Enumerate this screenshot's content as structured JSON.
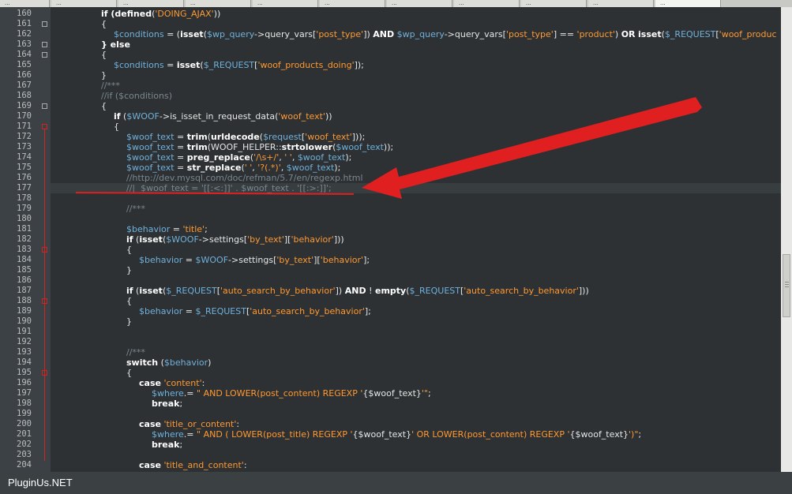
{
  "tabs": [
    "...",
    "...",
    "...",
    "...",
    "...",
    "...",
    "...",
    "...",
    "...",
    "...",
    "..."
  ],
  "footer": {
    "brand": "PluginUs.NET"
  },
  "annotation": {
    "color": "#e02020",
    "kind": "arrow-pointing-left"
  },
  "lines": [
    {
      "n": "160",
      "fold": "none",
      "indent": 2,
      "segs": [
        [
          "kw",
          "if ("
        ],
        [
          "fn",
          "defined"
        ],
        [
          "plain",
          "("
        ],
        [
          "str",
          "'DOING_AJAX'"
        ],
        [
          "plain",
          "))"
        ]
      ]
    },
    {
      "n": "161",
      "fold": "box",
      "indent": 2,
      "segs": [
        [
          "plain",
          "{"
        ]
      ]
    },
    {
      "n": "162",
      "fold": "none",
      "indent": 3,
      "segs": [
        [
          "var",
          "$conditions"
        ],
        [
          "plain",
          " = ("
        ],
        [
          "fn",
          "isset"
        ],
        [
          "plain",
          "("
        ],
        [
          "var",
          "$wp_query"
        ],
        [
          "plain",
          "->query_vars["
        ],
        [
          "str",
          "'post_type'"
        ],
        [
          "plain",
          "]) "
        ],
        [
          "kw",
          "AND"
        ],
        [
          "plain",
          " "
        ],
        [
          "var",
          "$wp_query"
        ],
        [
          "plain",
          "->query_vars["
        ],
        [
          "str",
          "'post_type'"
        ],
        [
          "plain",
          "] == "
        ],
        [
          "str",
          "'product'"
        ],
        [
          "plain",
          ") "
        ],
        [
          "kw",
          "OR"
        ],
        [
          "plain",
          " "
        ],
        [
          "fn",
          "isset"
        ],
        [
          "plain",
          "("
        ],
        [
          "var",
          "$_REQUEST"
        ],
        [
          "plain",
          "["
        ],
        [
          "str",
          "'woof_produc"
        ]
      ]
    },
    {
      "n": "163",
      "fold": "box",
      "indent": 2,
      "segs": [
        [
          "kw",
          "} else"
        ]
      ]
    },
    {
      "n": "164",
      "fold": "box",
      "indent": 2,
      "segs": [
        [
          "plain",
          "{"
        ]
      ]
    },
    {
      "n": "165",
      "fold": "none",
      "indent": 3,
      "segs": [
        [
          "var",
          "$conditions"
        ],
        [
          "plain",
          " = "
        ],
        [
          "fn",
          "isset"
        ],
        [
          "plain",
          "("
        ],
        [
          "var",
          "$_REQUEST"
        ],
        [
          "plain",
          "["
        ],
        [
          "str",
          "'woof_products_doing'"
        ],
        [
          "plain",
          "]);"
        ]
      ]
    },
    {
      "n": "166",
      "fold": "none",
      "indent": 2,
      "segs": [
        [
          "plain",
          "}"
        ]
      ]
    },
    {
      "n": "167",
      "fold": "none",
      "indent": 2,
      "segs": [
        [
          "cmt",
          "//***"
        ]
      ]
    },
    {
      "n": "168",
      "fold": "none",
      "indent": 2,
      "segs": [
        [
          "cmt",
          "//if ($conditions)"
        ]
      ]
    },
    {
      "n": "169",
      "fold": "box",
      "indent": 2,
      "segs": [
        [
          "plain",
          "{"
        ]
      ]
    },
    {
      "n": "170",
      "fold": "none",
      "indent": 3,
      "segs": [
        [
          "kw",
          "if"
        ],
        [
          "plain",
          " ("
        ],
        [
          "var",
          "$WOOF"
        ],
        [
          "plain",
          "->is_isset_in_request_data("
        ],
        [
          "str",
          "'woof_text'"
        ],
        [
          "plain",
          "))"
        ]
      ]
    },
    {
      "n": "171",
      "fold": "redbox",
      "indent": 3,
      "segs": [
        [
          "plain",
          "{"
        ]
      ]
    },
    {
      "n": "172",
      "fold": "none",
      "indent": 4,
      "segs": [
        [
          "var",
          "$woof_text"
        ],
        [
          "plain",
          " = "
        ],
        [
          "fn",
          "trim"
        ],
        [
          "plain",
          "("
        ],
        [
          "fn",
          "urldecode"
        ],
        [
          "plain",
          "("
        ],
        [
          "var",
          "$request"
        ],
        [
          "plain",
          "["
        ],
        [
          "str",
          "'woof_text'"
        ],
        [
          "plain",
          "]));"
        ]
      ]
    },
    {
      "n": "173",
      "fold": "none",
      "indent": 4,
      "segs": [
        [
          "var",
          "$woof_text"
        ],
        [
          "plain",
          " = "
        ],
        [
          "fn",
          "trim"
        ],
        [
          "plain",
          "(WOOF_HELPER::"
        ],
        [
          "fn",
          "strtolower"
        ],
        [
          "plain",
          "("
        ],
        [
          "var",
          "$woof_text"
        ],
        [
          "plain",
          "));"
        ]
      ]
    },
    {
      "n": "174",
      "fold": "none",
      "indent": 4,
      "segs": [
        [
          "var",
          "$woof_text"
        ],
        [
          "plain",
          " = "
        ],
        [
          "fn",
          "preg_replace"
        ],
        [
          "plain",
          "("
        ],
        [
          "str",
          "'/\\s+/'"
        ],
        [
          "plain",
          ", "
        ],
        [
          "str",
          "' '"
        ],
        [
          "plain",
          ", "
        ],
        [
          "var",
          "$woof_text"
        ],
        [
          "plain",
          ");"
        ]
      ]
    },
    {
      "n": "175",
      "fold": "none",
      "indent": 4,
      "segs": [
        [
          "var",
          "$woof_text"
        ],
        [
          "plain",
          " = "
        ],
        [
          "fn",
          "str_replace"
        ],
        [
          "plain",
          "("
        ],
        [
          "str",
          "' '"
        ],
        [
          "plain",
          ", "
        ],
        [
          "str",
          "'?(.*)'"
        ],
        [
          "plain",
          ", "
        ],
        [
          "var",
          "$woof_text"
        ],
        [
          "plain",
          ");"
        ]
      ]
    },
    {
      "n": "176",
      "fold": "none",
      "indent": 4,
      "segs": [
        [
          "cmt",
          "//http://dev.mysql.com/doc/refman/5.7/en/regexp.html"
        ]
      ]
    },
    {
      "n": "177",
      "fold": "none",
      "indent": 4,
      "sel": true,
      "segs": [
        [
          "cmt",
          "//|  $woof_text = '[[:<:]]' . $woof_text . '[[:>:]]';"
        ]
      ]
    },
    {
      "n": "178",
      "fold": "none",
      "indent": 4,
      "segs": []
    },
    {
      "n": "179",
      "fold": "none",
      "indent": 4,
      "segs": [
        [
          "cmt",
          "//***"
        ]
      ]
    },
    {
      "n": "180",
      "fold": "none",
      "indent": 4,
      "segs": []
    },
    {
      "n": "181",
      "fold": "none",
      "indent": 4,
      "segs": [
        [
          "var",
          "$behavior"
        ],
        [
          "plain",
          " = "
        ],
        [
          "str",
          "'title'"
        ],
        [
          "plain",
          ";"
        ]
      ]
    },
    {
      "n": "182",
      "fold": "none",
      "indent": 4,
      "segs": [
        [
          "kw",
          "if"
        ],
        [
          "plain",
          " ("
        ],
        [
          "fn",
          "isset"
        ],
        [
          "plain",
          "("
        ],
        [
          "var",
          "$WOOF"
        ],
        [
          "plain",
          "->settings["
        ],
        [
          "str",
          "'by_text'"
        ],
        [
          "plain",
          "]["
        ],
        [
          "str",
          "'behavior'"
        ],
        [
          "plain",
          "]))"
        ]
      ]
    },
    {
      "n": "183",
      "fold": "redbox",
      "indent": 4,
      "segs": [
        [
          "plain",
          "{"
        ]
      ]
    },
    {
      "n": "184",
      "fold": "none",
      "indent": 5,
      "segs": [
        [
          "var",
          "$behavior"
        ],
        [
          "plain",
          " = "
        ],
        [
          "var",
          "$WOOF"
        ],
        [
          "plain",
          "->settings["
        ],
        [
          "str",
          "'by_text'"
        ],
        [
          "plain",
          "]["
        ],
        [
          "str",
          "'behavior'"
        ],
        [
          "plain",
          "];"
        ]
      ]
    },
    {
      "n": "185",
      "fold": "none",
      "indent": 4,
      "segs": [
        [
          "plain",
          "}"
        ]
      ]
    },
    {
      "n": "186",
      "fold": "none",
      "indent": 4,
      "segs": []
    },
    {
      "n": "187",
      "fold": "none",
      "indent": 4,
      "segs": [
        [
          "kw",
          "if"
        ],
        [
          "plain",
          " ("
        ],
        [
          "fn",
          "isset"
        ],
        [
          "plain",
          "("
        ],
        [
          "var",
          "$_REQUEST"
        ],
        [
          "plain",
          "["
        ],
        [
          "str",
          "'auto_search_by_behavior'"
        ],
        [
          "plain",
          "]) "
        ],
        [
          "kw",
          "AND"
        ],
        [
          "plain",
          " ! "
        ],
        [
          "fn",
          "empty"
        ],
        [
          "plain",
          "("
        ],
        [
          "var",
          "$_REQUEST"
        ],
        [
          "plain",
          "["
        ],
        [
          "str",
          "'auto_search_by_behavior'"
        ],
        [
          "plain",
          "]))"
        ]
      ]
    },
    {
      "n": "188",
      "fold": "redbox",
      "indent": 4,
      "segs": [
        [
          "plain",
          "{"
        ]
      ]
    },
    {
      "n": "189",
      "fold": "none",
      "indent": 5,
      "segs": [
        [
          "var",
          "$behavior"
        ],
        [
          "plain",
          " = "
        ],
        [
          "var",
          "$_REQUEST"
        ],
        [
          "plain",
          "["
        ],
        [
          "str",
          "'auto_search_by_behavior'"
        ],
        [
          "plain",
          "];"
        ]
      ]
    },
    {
      "n": "190",
      "fold": "none",
      "indent": 4,
      "segs": [
        [
          "plain",
          "}"
        ]
      ]
    },
    {
      "n": "191",
      "fold": "none",
      "indent": 4,
      "segs": []
    },
    {
      "n": "192",
      "fold": "none",
      "indent": 4,
      "segs": []
    },
    {
      "n": "193",
      "fold": "none",
      "indent": 4,
      "segs": [
        [
          "cmt",
          "//***"
        ]
      ]
    },
    {
      "n": "194",
      "fold": "none",
      "indent": 4,
      "segs": [
        [
          "kw",
          "switch"
        ],
        [
          "plain",
          " ("
        ],
        [
          "var",
          "$behavior"
        ],
        [
          "plain",
          ")"
        ]
      ]
    },
    {
      "n": "195",
      "fold": "redbox",
      "indent": 4,
      "segs": [
        [
          "plain",
          "{"
        ]
      ]
    },
    {
      "n": "196",
      "fold": "none",
      "indent": 5,
      "segs": [
        [
          "kw",
          "case"
        ],
        [
          "plain",
          " "
        ],
        [
          "str",
          "'content'"
        ],
        [
          "plain",
          ":"
        ]
      ]
    },
    {
      "n": "197",
      "fold": "none",
      "indent": 6,
      "segs": [
        [
          "var",
          "$where"
        ],
        [
          "plain",
          ".= "
        ],
        [
          "str",
          "\" AND LOWER(post_content) REGEXP '"
        ],
        [
          "plain",
          "{$woof_text}"
        ],
        [
          "str",
          "'\""
        ],
        [
          "plain",
          ";"
        ]
      ]
    },
    {
      "n": "198",
      "fold": "none",
      "indent": 6,
      "segs": [
        [
          "kw",
          "break"
        ],
        [
          "plain",
          ";"
        ]
      ]
    },
    {
      "n": "199",
      "fold": "none",
      "indent": 5,
      "segs": []
    },
    {
      "n": "200",
      "fold": "none",
      "indent": 5,
      "segs": [
        [
          "kw",
          "case"
        ],
        [
          "plain",
          " "
        ],
        [
          "str",
          "'title_or_content'"
        ],
        [
          "plain",
          ":"
        ]
      ]
    },
    {
      "n": "201",
      "fold": "none",
      "indent": 6,
      "segs": [
        [
          "var",
          "$where"
        ],
        [
          "plain",
          ".= "
        ],
        [
          "str",
          "\" AND ( LOWER(post_title) REGEXP '"
        ],
        [
          "plain",
          "{$woof_text}"
        ],
        [
          "str",
          "' OR LOWER(post_content) REGEXP '"
        ],
        [
          "plain",
          "{$woof_text}"
        ],
        [
          "str",
          "')\""
        ],
        [
          "plain",
          ";"
        ]
      ]
    },
    {
      "n": "202",
      "fold": "none",
      "indent": 6,
      "segs": [
        [
          "kw",
          "break"
        ],
        [
          "plain",
          ";"
        ]
      ]
    },
    {
      "n": "203",
      "fold": "none",
      "indent": 5,
      "segs": []
    },
    {
      "n": "204",
      "fold": "none",
      "indent": 5,
      "segs": [
        [
          "kw",
          "case"
        ],
        [
          "plain",
          " "
        ],
        [
          "str",
          "'title_and_content'"
        ],
        [
          "plain",
          ":"
        ]
      ]
    }
  ]
}
